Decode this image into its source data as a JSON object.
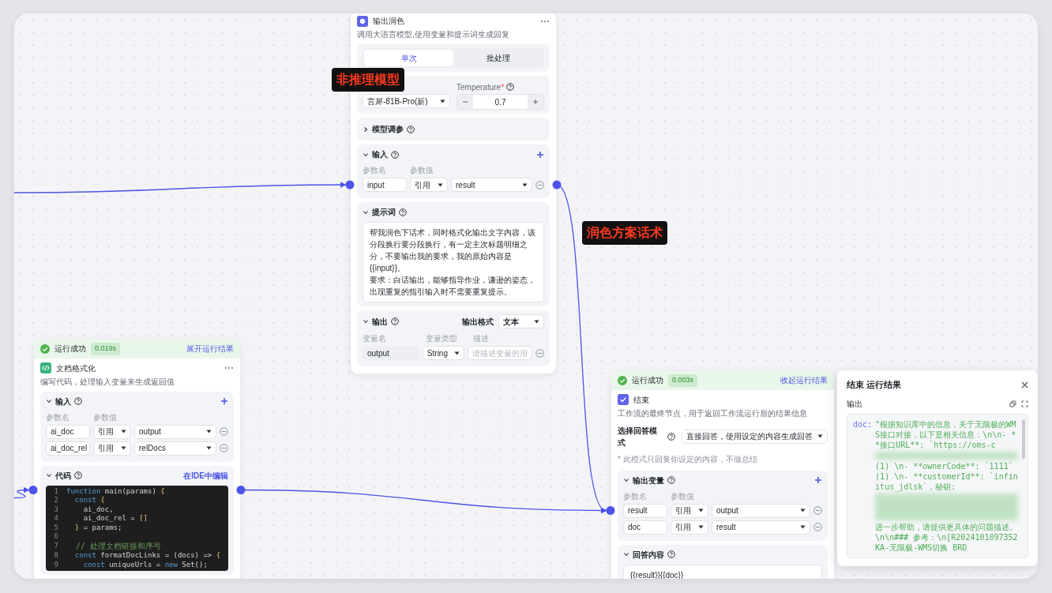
{
  "annotations": [
    {
      "text": "非推理模型"
    },
    {
      "text": "润色方案话术"
    }
  ],
  "nodes": [
    {
      "kind": "llm",
      "title": "输出润色",
      "description": "调用大语言模型,使用变量和提示词生成回复",
      "sections": [
        {
          "kind": "mode_tabs",
          "tabs": [
            {
              "label": "单次",
              "selected": true
            },
            {
              "label": "批处理",
              "selected": false
            }
          ]
        },
        {
          "kind": "model",
          "model": "言犀-81B-Pro(新)",
          "temperature_label": "Temperature",
          "required_mark": "*",
          "temperature": "0.7"
        },
        {
          "kind": "collapsible",
          "title": "模型调参",
          "expanded": false
        },
        {
          "kind": "inputs",
          "title": "输入",
          "expanded": true,
          "columns": [
            "参数名",
            "参数值"
          ],
          "rows": [
            {
              "name": "input",
              "source": "引用",
              "value": "result"
            }
          ]
        },
        {
          "kind": "prompt",
          "title": "提示词",
          "expanded": true,
          "paragraphs": [
            "帮我润色下话术，同时格式化输出文字内容，该分段换行要分段换行，有一定主次标题明细之分，不要输出我的要求，我的原始内容是{{input}}。",
            "要求：白话输出，能够指导作业，谦逊的姿态，出现重复的指引输入时不需要重复提示。"
          ]
        },
        {
          "kind": "outputs",
          "title": "输出",
          "expanded": true,
          "format_label": "输出格式",
          "format": "文本",
          "columns": [
            "变量名",
            "变量类型",
            "描述"
          ],
          "rows": [
            {
              "name": "output",
              "type": "String",
              "placeholder": "请描述变量的用"
            }
          ]
        }
      ]
    },
    {
      "kind": "code",
      "status": {
        "text": "运行成功",
        "time": "0.019s",
        "action": "展开运行结果"
      },
      "title": "文档格式化",
      "description": "编写代码，处理输入变量来生成返回值",
      "sections": [
        {
          "kind": "inputs",
          "title": "输入",
          "expanded": true,
          "columns": [
            "参数名",
            "参数值"
          ],
          "rows": [
            {
              "name": "ai_doc",
              "source": "引用",
              "value": "output"
            },
            {
              "name": "ai_doc_rel",
              "source": "引用",
              "value": "relDocs"
            }
          ]
        },
        {
          "kind": "code",
          "title": "代码",
          "expanded": true,
          "link": "在IDE中编辑",
          "lines": [
            {
              "number": "1",
              "tokens": [
                {
                  "kind": "keyword",
                  "text": "function"
                },
                {
                  "kind": "plain",
                  "text": " main(params) "
                },
                {
                  "kind": "bracket",
                  "text": "{"
                }
              ]
            },
            {
              "number": "2",
              "tokens": [
                {
                  "kind": "keyword",
                  "text": "  const"
                },
                {
                  "kind": "bracket",
                  "text": " {"
                }
              ]
            },
            {
              "number": "3",
              "tokens": [
                {
                  "kind": "plain",
                  "text": "    ai_doc,"
                }
              ]
            },
            {
              "number": "4",
              "tokens": [
                {
                  "kind": "plain",
                  "text": "    ai_doc_rel = "
                },
                {
                  "kind": "bracket",
                  "text": "[]"
                }
              ]
            },
            {
              "number": "5",
              "tokens": [
                {
                  "kind": "bracket",
                  "text": "  }"
                },
                {
                  "kind": "plain",
                  "text": " = params;"
                }
              ]
            },
            {
              "number": "6"
            },
            {
              "number": "7",
              "tokens": [
                {
                  "kind": "comment",
                  "text": "  // 处理文档链接和序号"
                }
              ]
            },
            {
              "number": "8",
              "tokens": [
                {
                  "kind": "keyword",
                  "text": "  const"
                },
                {
                  "kind": "plain",
                  "text": " formatDocLinks = (docs) => "
                },
                {
                  "kind": "bracket",
                  "text": "{"
                }
              ]
            },
            {
              "number": "9",
              "tokens": [
                {
                  "kind": "keyword",
                  "text": "    const"
                },
                {
                  "kind": "plain",
                  "text": " uniqueUrls = "
                },
                {
                  "kind": "keyword",
                  "text": "new"
                },
                {
                  "kind": "plain",
                  "text": " Set();"
                }
              ]
            }
          ]
        }
      ]
    },
    {
      "kind": "end",
      "status": {
        "text": "运行成功",
        "time": "0.003s",
        "action": "收起运行结果"
      },
      "title": "结束",
      "description": "工作流的最终节点，用于返回工作流运行后的结果信息",
      "sections": [
        {
          "kind": "answer_mode",
          "label": "选择回答模式",
          "value": "直接回答，使用设定的内容生成回答",
          "note": "* 此模式只回复你设定的内容，不做总结"
        },
        {
          "kind": "inputs",
          "title": "输出变量",
          "expanded": true,
          "columns": [
            "参数名",
            "参数值"
          ],
          "rows": [
            {
              "name": "result",
              "source": "引用",
              "value": "output"
            },
            {
              "name": "doc",
              "source": "引用",
              "value": "result"
            }
          ]
        },
        {
          "kind": "answer",
          "title": "回答内容",
          "expanded": true,
          "text": "{{result}}{{doc}}"
        }
      ]
    }
  ],
  "result_panel": {
    "title": "结束 运行结果",
    "output_label": "输出",
    "key": "doc:",
    "content": [
      {
        "kind": "text",
        "text": "\"根据知识库中的信息，关于无限极的WMS接口对接，以下是相关信息：\\n\\n- **接口URL**: `https://oms-c"
      },
      {
        "kind": "blurred",
        "large": false
      },
      {
        "kind": "text",
        "text": "(1) \\n- **ownerCode**: `1111` (1) \\n- **customerId**: `infinitus_jdlsk`，秘钥:"
      },
      {
        "kind": "blurred",
        "large": true
      },
      {
        "kind": "text",
        "text": "进一步帮助，请提供更具体的问题描述。\\n\\n### 参考：\\n[R2024101097352 KA-无限极-WMS切换 BRD"
      }
    ]
  }
}
